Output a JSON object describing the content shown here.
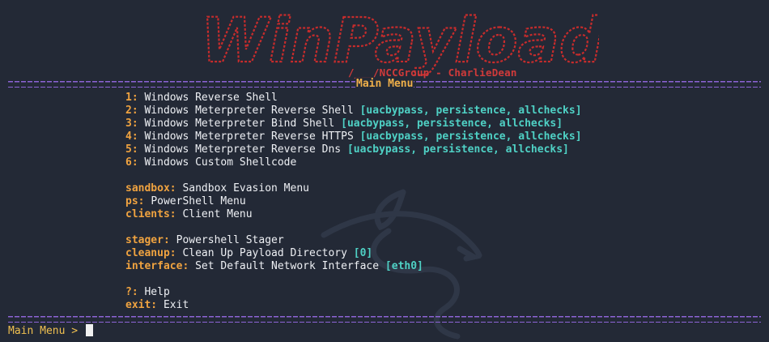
{
  "banner": {
    "title": "WinPayloads",
    "credit": "/___/NCCGroup - CharlieDean"
  },
  "header": {
    "menu_title": "Main Menu"
  },
  "payloads": [
    {
      "key": "1:",
      "label": "Windows Reverse Shell",
      "options": ""
    },
    {
      "key": "2:",
      "label": "Windows Meterpreter Reverse Shell",
      "options": "[uacbypass, persistence, allchecks]"
    },
    {
      "key": "3:",
      "label": "Windows Meterpreter Bind Shell",
      "options": "[uacbypass, persistence, allchecks]"
    },
    {
      "key": "4:",
      "label": "Windows Meterpreter Reverse HTTPS",
      "options": "[uacbypass, persistence, allchecks]"
    },
    {
      "key": "5:",
      "label": "Windows Meterpreter Reverse Dns",
      "options": "[uacbypass, persistence, allchecks]"
    },
    {
      "key": "6:",
      "label": "Windows Custom Shellcode",
      "options": ""
    }
  ],
  "submenus": [
    {
      "key": "sandbox:",
      "label": "Sandbox Evasion Menu"
    },
    {
      "key": "ps:",
      "label": "PowerShell Menu"
    },
    {
      "key": "clients:",
      "label": "Client Menu"
    }
  ],
  "utilities": [
    {
      "key": "stager:",
      "label": "Powershell Stager",
      "options": ""
    },
    {
      "key": "cleanup:",
      "label": "Clean Up Payload Directory",
      "options": "[0]"
    },
    {
      "key": "interface:",
      "label": "Set Default Network Interface",
      "options": "[eth0]"
    }
  ],
  "misc": [
    {
      "key": "?:",
      "label": "Help"
    },
    {
      "key": "exit:",
      "label": "Exit"
    }
  ],
  "prompt": {
    "text": "Main Menu > "
  },
  "colors": {
    "background": "#232936",
    "banner_red": "#d03a3a",
    "key_orange": "#f0a340",
    "option_teal": "#4fd1c5",
    "rule_purple": "#8d64d6",
    "prompt_yellow": "#f0c050"
  },
  "icons": {
    "watermark": "kali-dragon-icon"
  }
}
